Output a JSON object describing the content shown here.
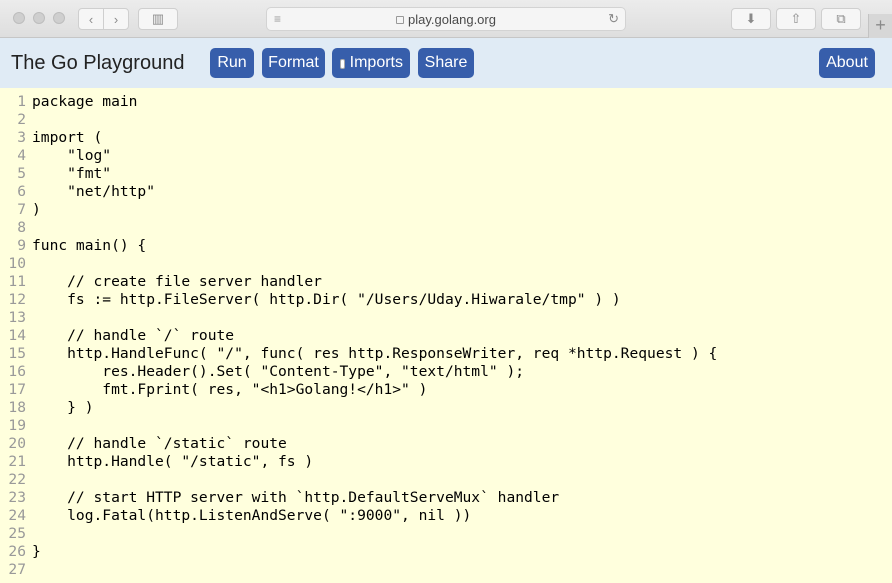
{
  "browser": {
    "url": "play.golang.org"
  },
  "header": {
    "title": "The Go Playground",
    "buttons": {
      "run": "Run",
      "format": "Format",
      "imports": "Imports",
      "share": "Share",
      "about": "About"
    },
    "imports_checked": false
  },
  "editor": {
    "lines": [
      {
        "num": "1",
        "text": "package main"
      },
      {
        "num": "2",
        "text": ""
      },
      {
        "num": "3",
        "text": "import ("
      },
      {
        "num": "4",
        "text": "    \"log\""
      },
      {
        "num": "5",
        "text": "    \"fmt\""
      },
      {
        "num": "6",
        "text": "    \"net/http\""
      },
      {
        "num": "7",
        "text": ")"
      },
      {
        "num": "8",
        "text": ""
      },
      {
        "num": "9",
        "text": "func main() {"
      },
      {
        "num": "10",
        "text": ""
      },
      {
        "num": "11",
        "text": "    // create file server handler"
      },
      {
        "num": "12",
        "text": "    fs := http.FileServer( http.Dir( \"/Users/Uday.Hiwarale/tmp\" ) )"
      },
      {
        "num": "13",
        "text": ""
      },
      {
        "num": "14",
        "text": "    // handle `/` route"
      },
      {
        "num": "15",
        "text": "    http.HandleFunc( \"/\", func( res http.ResponseWriter, req *http.Request ) {"
      },
      {
        "num": "16",
        "text": "        res.Header().Set( \"Content-Type\", \"text/html\" );"
      },
      {
        "num": "17",
        "text": "        fmt.Fprint( res, \"<h1>Golang!</h1>\" )"
      },
      {
        "num": "18",
        "text": "    } )"
      },
      {
        "num": "19",
        "text": ""
      },
      {
        "num": "20",
        "text": "    // handle `/static` route"
      },
      {
        "num": "21",
        "text": "    http.Handle( \"/static\", fs )"
      },
      {
        "num": "22",
        "text": ""
      },
      {
        "num": "23",
        "text": "    // start HTTP server with `http.DefaultServeMux` handler"
      },
      {
        "num": "24",
        "text": "    log.Fatal(http.ListenAndServe( \":9000\", nil ))"
      },
      {
        "num": "25",
        "text": ""
      },
      {
        "num": "26",
        "text": "}"
      },
      {
        "num": "27",
        "text": ""
      }
    ]
  },
  "colors": {
    "button_blue": "#375eab",
    "header_bg": "#e0ebf5",
    "editor_bg": "#ffffdd",
    "line_number": "#999999"
  }
}
